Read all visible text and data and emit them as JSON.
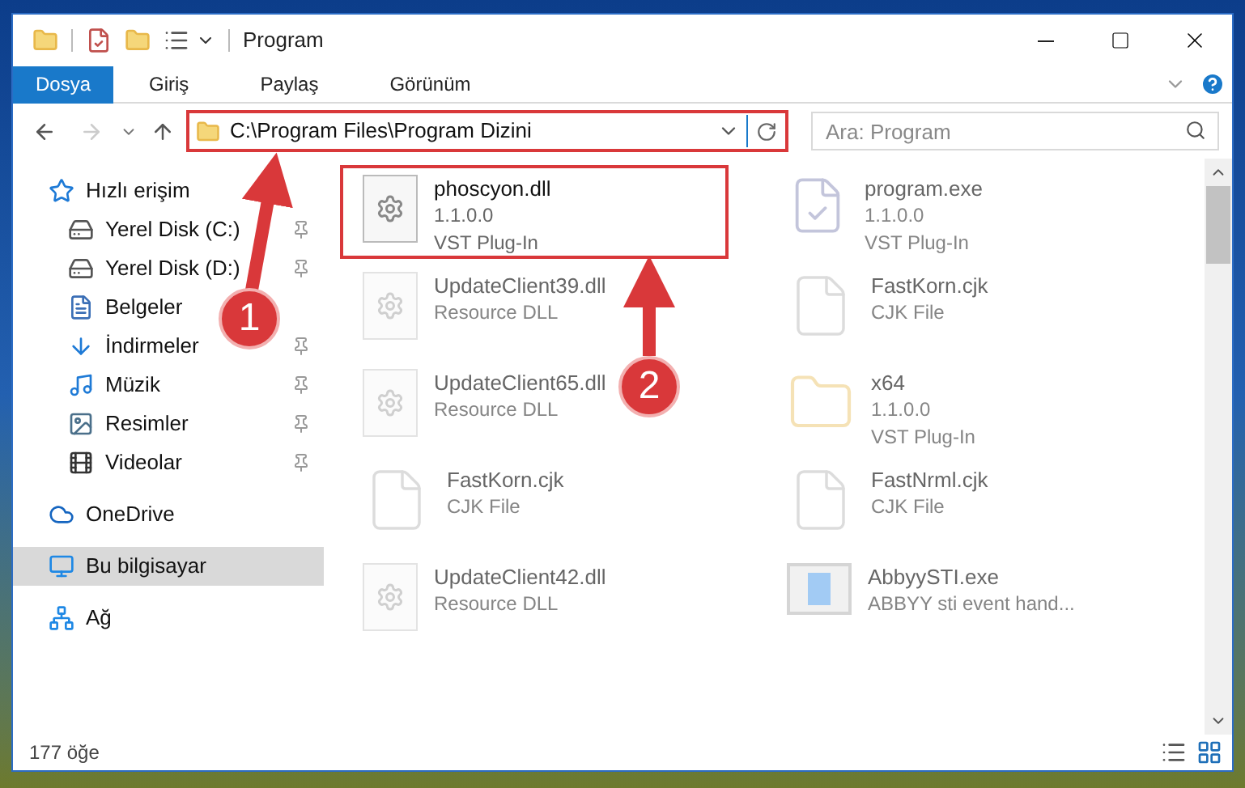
{
  "window": {
    "title": "Program"
  },
  "ribbon_tabs": [
    {
      "label": "Dosya",
      "selected": true
    },
    {
      "label": "Giriş",
      "selected": false
    },
    {
      "label": "Paylaş",
      "selected": false
    },
    {
      "label": "Görünüm",
      "selected": false
    }
  ],
  "address_bar": {
    "path": "C:\\Program Files\\Program Dizini",
    "highlighted": true
  },
  "search": {
    "placeholder": "Ara: Program"
  },
  "sidebar": {
    "items": [
      {
        "label": "Hızlı erişim",
        "kind": "star",
        "selected": false,
        "children": [
          {
            "label": "Yerel Disk (C:)",
            "kind": "disk",
            "pinned": true,
            "selected": false
          },
          {
            "label": "Yerel Disk (D:)",
            "kind": "disk",
            "pinned": true,
            "selected": false
          },
          {
            "label": "Belgeler",
            "kind": "document",
            "selected": false
          },
          {
            "label": "İndirmeler",
            "kind": "download",
            "pinned": true,
            "selected": false
          },
          {
            "label": "Müzik",
            "kind": "music",
            "pinned": true,
            "selected": false
          },
          {
            "label": "Resimler",
            "kind": "picture",
            "pinned": true,
            "selected": false
          },
          {
            "label": "Videolar",
            "kind": "video",
            "pinned": true,
            "selected": false
          }
        ]
      },
      {
        "label": "OneDrive",
        "kind": "cloud",
        "selected": false
      },
      {
        "label": "Bu bilgisayar",
        "kind": "computer",
        "selected": true
      },
      {
        "label": "Ağ",
        "kind": "network",
        "selected": false
      }
    ]
  },
  "files": [
    {
      "name": "phoscyon.dll",
      "kind": "dll",
      "lines": [
        "1.1.0.0",
        "VST Plug-In"
      ],
      "dimmed": false,
      "highlighted": true
    },
    {
      "name": "program.exe",
      "kind": "exe",
      "lines": [
        "1.1.0.0",
        "VST Plug-In"
      ],
      "dimmed": true,
      "highlighted": false
    },
    {
      "name": "UpdateClient39.dll",
      "kind": "dll",
      "lines": [
        "Resource DLL"
      ],
      "dimmed": true,
      "highlighted": false
    },
    {
      "name": "FastKorn.cjk",
      "kind": "file",
      "lines": [
        "CJK File"
      ],
      "dimmed": true,
      "highlighted": false
    },
    {
      "name": "UpdateClient65.dll",
      "kind": "dll",
      "lines": [
        "Resource DLL"
      ],
      "dimmed": true,
      "highlighted": false
    },
    {
      "name": "x64",
      "kind": "folder",
      "lines": [
        "1.1.0.0",
        "VST Plug-In"
      ],
      "dimmed": true,
      "highlighted": false
    },
    {
      "name": "FastKorn.cjk",
      "kind": "file",
      "lines": [
        "CJK File"
      ],
      "dimmed": true,
      "highlighted": false
    },
    {
      "name": "FastNrml.cjk",
      "kind": "file",
      "lines": [
        "CJK File"
      ],
      "dimmed": true,
      "highlighted": false
    },
    {
      "name": "UpdateClient42.dll",
      "kind": "dll",
      "lines": [
        "Resource DLL"
      ],
      "dimmed": true,
      "highlighted": false
    },
    {
      "name": "AbbyySTI.exe",
      "kind": "app",
      "lines": [
        "ABBYY sti event hand..."
      ],
      "dimmed": true,
      "highlighted": false
    }
  ],
  "status_bar": {
    "count": "177 öğe"
  },
  "callouts": [
    {
      "number": "1"
    },
    {
      "number": "2"
    }
  ]
}
